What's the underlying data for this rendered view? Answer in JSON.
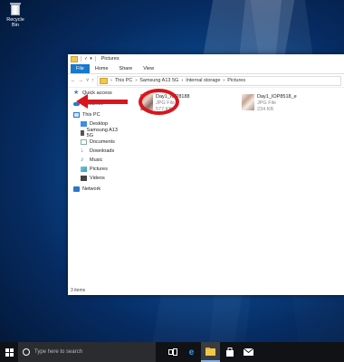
{
  "desktop": {
    "recycle_bin_label": "Recycle Bin"
  },
  "window": {
    "title": "Pictures",
    "ribbon_tabs": [
      "File",
      "Home",
      "Share",
      "View"
    ],
    "breadcrumb": [
      "This PC",
      "Samsung A13 5G",
      "Internal storage",
      "Pictures"
    ],
    "nav_items": [
      {
        "label": "Quick access",
        "icon": "star-icon"
      },
      {
        "label": "OneDrive",
        "icon": "cloud-icon"
      },
      {
        "label": "This PC",
        "icon": "pc-icon"
      },
      {
        "label": "Desktop",
        "icon": "desktop-icon"
      },
      {
        "label": "Samsung A13 5G",
        "icon": "phone-icon"
      },
      {
        "label": "Documents",
        "icon": "documents-icon"
      },
      {
        "label": "Downloads",
        "icon": "downloads-icon"
      },
      {
        "label": "Music",
        "icon": "music-icon"
      },
      {
        "label": "Pictures",
        "icon": "pictures-icon"
      },
      {
        "label": "Videos",
        "icon": "videos-icon"
      },
      {
        "label": "Network",
        "icon": "network-icon"
      }
    ],
    "files": [
      {
        "name": "Day1_IOP8188",
        "type": "JPG File",
        "size": "577 KB"
      },
      {
        "name": "Day1_IOP8518_e",
        "type": "JPG File",
        "size": "234 KB"
      }
    ],
    "status": "3 items"
  },
  "taskbar": {
    "search_placeholder": "Type here to search",
    "icons": [
      "task-view-icon",
      "edge-icon",
      "file-explorer-icon",
      "store-icon",
      "mail-icon"
    ]
  },
  "colors": {
    "annotation": "#d8161d",
    "ribbon_file": "#1979ca"
  }
}
